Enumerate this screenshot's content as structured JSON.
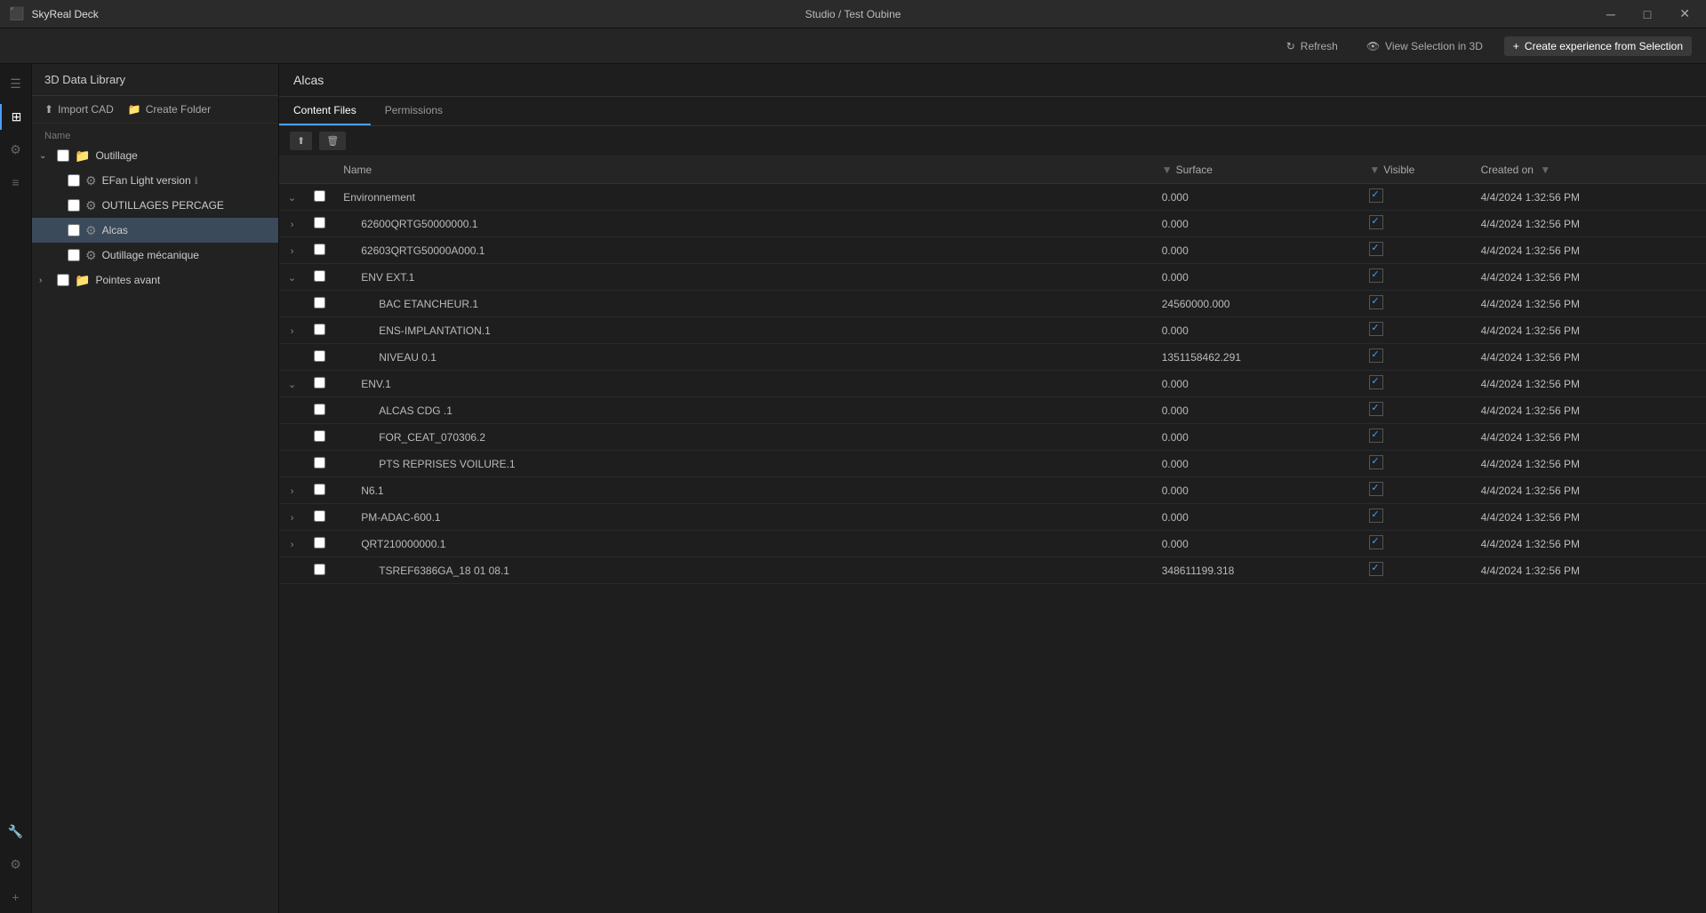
{
  "titlebar": {
    "app_name": "SkyReal Deck",
    "title": "Studio / Test Oubine",
    "minimize": "─",
    "maximize": "□",
    "close": "✕"
  },
  "toolbar": {
    "refresh_label": "Refresh",
    "view_selection_label": "View Selection in 3D",
    "create_experience_label": "Create experience from Selection"
  },
  "sidebar": {
    "header": "3D Data Library",
    "import_label": "Import CAD",
    "create_folder_label": "Create Folder",
    "tree": [
      {
        "id": "outillage",
        "level": 1,
        "icon": "folder",
        "label": "Outillage",
        "expanded": true,
        "hasChildren": true
      },
      {
        "id": "efan",
        "level": 2,
        "icon": "gear",
        "label": "EFan Light version",
        "expanded": false,
        "hasInfo": true
      },
      {
        "id": "outillages-percage",
        "level": 2,
        "icon": "gear",
        "label": "OUTILLAGES PERCAGE",
        "expanded": false
      },
      {
        "id": "alcas",
        "level": 2,
        "icon": "gear",
        "label": "Alcas",
        "expanded": false,
        "selected": true
      },
      {
        "id": "outillage-mecanique",
        "level": 2,
        "icon": "gear",
        "label": "Outillage mécanique",
        "expanded": false
      },
      {
        "id": "pointes-avant",
        "level": 1,
        "icon": "folder",
        "label": "Pointes avant",
        "expanded": false,
        "hasChildren": true
      }
    ]
  },
  "content": {
    "breadcrumb": "Alcas",
    "tabs": [
      {
        "id": "content-files",
        "label": "Content Files",
        "active": true
      },
      {
        "id": "permissions",
        "label": "Permissions",
        "active": false
      }
    ],
    "table": {
      "columns": [
        {
          "id": "name",
          "label": "Name"
        },
        {
          "id": "surface",
          "label": "Surface"
        },
        {
          "id": "visible",
          "label": "Visible"
        },
        {
          "id": "created",
          "label": "Created on"
        }
      ],
      "rows": [
        {
          "id": "env",
          "name": "Environnement",
          "surface": "0.000",
          "visible": true,
          "created": "4/4/2024 1:32:56 PM",
          "level": 0,
          "expandable": true,
          "expanded": true
        },
        {
          "id": "q1",
          "name": "62600QRTG50000000.1",
          "surface": "0.000",
          "visible": true,
          "created": "4/4/2024 1:32:56 PM",
          "level": 1,
          "expandable": true,
          "expanded": false
        },
        {
          "id": "q2",
          "name": "62603QRTG50000A000.1",
          "surface": "0.000",
          "visible": true,
          "created": "4/4/2024 1:32:56 PM",
          "level": 1,
          "expandable": true,
          "expanded": false
        },
        {
          "id": "env-ext",
          "name": "ENV EXT.1",
          "surface": "0.000",
          "visible": true,
          "created": "4/4/2024 1:32:56 PM",
          "level": 1,
          "expandable": true,
          "expanded": true
        },
        {
          "id": "bac",
          "name": "BAC ETANCHEUR.1",
          "surface": "24560000.000",
          "visible": true,
          "created": "4/4/2024 1:32:56 PM",
          "level": 2,
          "expandable": false,
          "expanded": false
        },
        {
          "id": "ens",
          "name": "ENS-IMPLANTATION.1",
          "surface": "0.000",
          "visible": true,
          "created": "4/4/2024 1:32:56 PM",
          "level": 2,
          "expandable": true,
          "expanded": false
        },
        {
          "id": "niveau",
          "name": "NIVEAU 0.1",
          "surface": "1351158462.291",
          "visible": true,
          "created": "4/4/2024 1:32:56 PM",
          "level": 2,
          "expandable": false,
          "expanded": false
        },
        {
          "id": "env1",
          "name": "ENV.1",
          "surface": "0.000",
          "visible": true,
          "created": "4/4/2024 1:32:56 PM",
          "level": 1,
          "expandable": true,
          "expanded": true
        },
        {
          "id": "alcas-cdg",
          "name": "ALCAS CDG .1",
          "surface": "0.000",
          "visible": true,
          "created": "4/4/2024 1:32:56 PM",
          "level": 2,
          "expandable": false
        },
        {
          "id": "for-ceat",
          "name": "FOR_CEAT_070306.2",
          "surface": "0.000",
          "visible": true,
          "created": "4/4/2024 1:32:56 PM",
          "level": 2,
          "expandable": false
        },
        {
          "id": "pts",
          "name": "PTS REPRISES VOILURE.1",
          "surface": "0.000",
          "visible": true,
          "created": "4/4/2024 1:32:56 PM",
          "level": 2,
          "expandable": false
        },
        {
          "id": "n6",
          "name": "N6.1",
          "surface": "0.000",
          "visible": true,
          "created": "4/4/2024 1:32:56 PM",
          "level": 1,
          "expandable": true,
          "expanded": false
        },
        {
          "id": "pm-adac",
          "name": "PM-ADAC-600.1",
          "surface": "0.000",
          "visible": true,
          "created": "4/4/2024 1:32:56 PM",
          "level": 1,
          "expandable": true,
          "expanded": false
        },
        {
          "id": "qrt",
          "name": "QRT210000000.1",
          "surface": "0.000",
          "visible": true,
          "created": "4/4/2024 1:32:56 PM",
          "level": 1,
          "expandable": true,
          "expanded": false
        },
        {
          "id": "tsref",
          "name": "TSREF6386GA_18 01 08.1",
          "surface": "348611199.318",
          "visible": true,
          "created": "4/4/2024 1:32:56 PM",
          "level": 2,
          "expandable": false
        }
      ]
    }
  },
  "icons": {
    "app": "⬛",
    "menu": "☰",
    "layers": "⊞",
    "settings": "⚙",
    "list": "≡",
    "refresh": "↻",
    "eye": "👁",
    "cube": "⬡",
    "plus": "+",
    "folder": "📁",
    "upload": "⬆",
    "filter": "▼",
    "check": "✓",
    "chevron_right": "›",
    "chevron_down": "⌄",
    "wrench": "🔧",
    "gear": "⚙",
    "grid": "⊞",
    "file": "📄"
  }
}
